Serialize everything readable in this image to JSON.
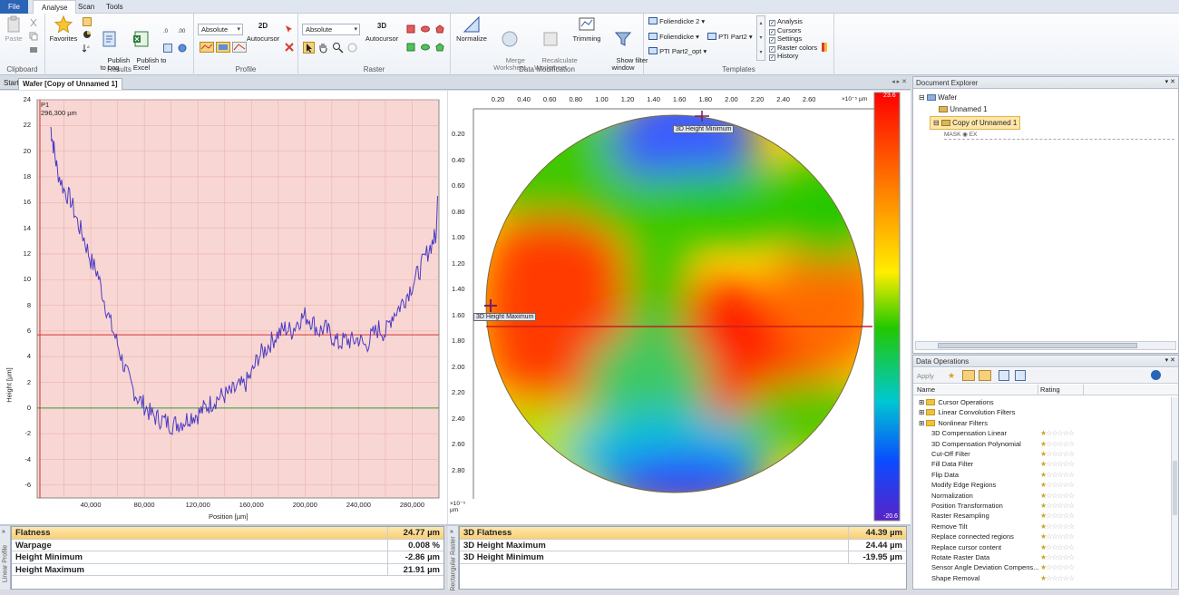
{
  "menu": {
    "items": [
      "File",
      "Analyse",
      "Scan",
      "Tools"
    ]
  },
  "ribbon": {
    "clipboard": {
      "group": "Clipboard",
      "paste": "Paste"
    },
    "results": {
      "group": "Results",
      "favorites": "Favorites",
      "publish_log": "Publish\nto Log",
      "publish_excel": "Publish to\nExcel"
    },
    "profile": {
      "group": "Profile",
      "combo": "Absolute",
      "tag": "2D",
      "autocursor": "Autocursor"
    },
    "raster": {
      "group": "Raster",
      "combo": "Absolute",
      "tag": "3D",
      "autocursor": "Autocursor"
    },
    "datamod": {
      "group": "Data Modification",
      "normalize": "Normalize",
      "merge": "Merge\nWorksheet",
      "recalc": "Recalculate\nWorksheet",
      "trimming": "Trimming",
      "showfilter": "Show filter\nwindow"
    },
    "templates": {
      "group": "Templates",
      "items": [
        "Foliendicke 2",
        "Foliendicke",
        "PTI Part2",
        "PTI Part2_opt"
      ],
      "checks": [
        "Analysis",
        "Cursors",
        "Settings",
        "Raster colors",
        "History"
      ]
    }
  },
  "tabs": {
    "start": "Start",
    "doc": "Wafer [Copy of Unnamed 1]"
  },
  "profile_plot": {
    "cursor_label": "P1",
    "cursor_value": "296,300 µm",
    "ylabel": "Height [µm]",
    "xlabel": "Position [µm]",
    "yticks": [
      "24",
      "22",
      "20",
      "18",
      "16",
      "14",
      "12",
      "10",
      "8",
      "6",
      "4",
      "2",
      "0",
      "-2",
      "-4",
      "-6"
    ],
    "xticks": [
      "40,000",
      "80,000",
      "120,000",
      "160,000",
      "200,000",
      "240,000",
      "280,000"
    ]
  },
  "chart_data": {
    "type": "line",
    "xlabel": "Position [µm]",
    "ylabel": "Height [µm]",
    "xlim": [
      0,
      300000
    ],
    "ylim": [
      -7,
      24
    ],
    "grid": true,
    "reference_lines": {
      "red": 5.7,
      "green": 0
    },
    "series": [
      {
        "x": [
          10000,
          12000,
          15000,
          20000,
          25000,
          30000,
          35000,
          40000,
          45000,
          50000,
          55000,
          60000,
          65000,
          70000,
          75000,
          80000,
          85000,
          90000,
          95000,
          100000,
          105000,
          110000,
          115000,
          120000,
          125000,
          130000,
          135000,
          140000,
          145000,
          150000,
          155000,
          160000,
          165000,
          170000,
          175000,
          180000,
          185000,
          190000,
          195000,
          200000,
          205000,
          210000,
          215000,
          220000,
          225000,
          230000,
          235000,
          240000,
          245000,
          250000,
          255000,
          260000,
          265000,
          270000,
          275000,
          280000,
          285000,
          290000,
          295000,
          298000
        ],
        "values": [
          21.9,
          20.5,
          18.5,
          17.0,
          16.2,
          14.5,
          13.2,
          11.5,
          10.5,
          8.4,
          6.5,
          5.0,
          3.2,
          1.8,
          0.8,
          0.2,
          -0.5,
          -0.8,
          -1.0,
          -1.3,
          -1.2,
          -1.0,
          -0.6,
          -0.5,
          0.0,
          0.4,
          0.8,
          1.0,
          1.2,
          1.6,
          1.8,
          2.6,
          4.0,
          4.5,
          5.2,
          5.8,
          6.2,
          6.0,
          6.8,
          7.2,
          6.8,
          6.0,
          6.2,
          5.6,
          5.0,
          5.3,
          5.2,
          5.4,
          4.8,
          5.6,
          6.2,
          5.8,
          7.2,
          7.8,
          8.6,
          9.6,
          10.6,
          11.8,
          12.9,
          13.5
        ]
      }
    ]
  },
  "raster_plot": {
    "xticks": [
      "0.20",
      "0.40",
      "0.60",
      "0.80",
      "1.00",
      "1.20",
      "1.40",
      "1.60",
      "1.80",
      "2.00",
      "2.20",
      "2.40",
      "2.60"
    ],
    "yticks": [
      "0.20",
      "0.40",
      "0.60",
      "0.80",
      "1.00",
      "1.20",
      "1.40",
      "1.60",
      "1.80",
      "2.00",
      "2.20",
      "2.40",
      "2.60",
      "2.80"
    ],
    "unit_x": "×10⁻⁵ µm",
    "unit_y": "×10⁻⁵ µm",
    "marker_min": "3D Height Minimum",
    "marker_max": "3D Height Maximum",
    "colorbar_top": "23.6",
    "colorbar_bottom": "-20.6"
  },
  "results_left": {
    "side": "Linear Profile",
    "rows": [
      {
        "name": "Flatness",
        "value": "24.77 µm"
      },
      {
        "name": "Warpage",
        "value": "0.008 %"
      },
      {
        "name": "Height Minimum",
        "value": "-2.86 µm"
      },
      {
        "name": "Height Maximum",
        "value": "21.91 µm"
      }
    ]
  },
  "results_right": {
    "side": "Rectangular Raster",
    "rows": [
      {
        "name": "3D Flatness",
        "value": "44.39 µm"
      },
      {
        "name": "3D Height Maximum",
        "value": "24.44 µm"
      },
      {
        "name": "3D Height Minimum",
        "value": "-19.95 µm"
      }
    ]
  },
  "explorer": {
    "title": "Document Explorer",
    "root": "Wafer",
    "items": [
      "Unnamed 1",
      "Copy of Unnamed 1"
    ],
    "mask_label": "MASK",
    "mask_tag": "EX"
  },
  "ops": {
    "title": "Data Operations",
    "apply": "Apply",
    "col_name": "Name",
    "col_rating": "Rating",
    "folders": [
      "Cursor Operations",
      "Linear Convolution Filters",
      "Nonlinear Filters"
    ],
    "items": [
      "3D Compensation Linear",
      "3D Compensation Polynomial",
      "Cut-Off Filter",
      "Fill Data Filter",
      "Flip Data",
      "Modify Edge Regions",
      "Normalization",
      "Position Transformation",
      "Raster Resampling",
      "Remove Tilt",
      "Replace connected regions",
      "Replace cursor content",
      "Rotate Raster Data",
      "Sensor Angle Deviation Compens...",
      "Shape Removal"
    ],
    "stars": "☆☆☆☆☆",
    "first_star": "★"
  }
}
